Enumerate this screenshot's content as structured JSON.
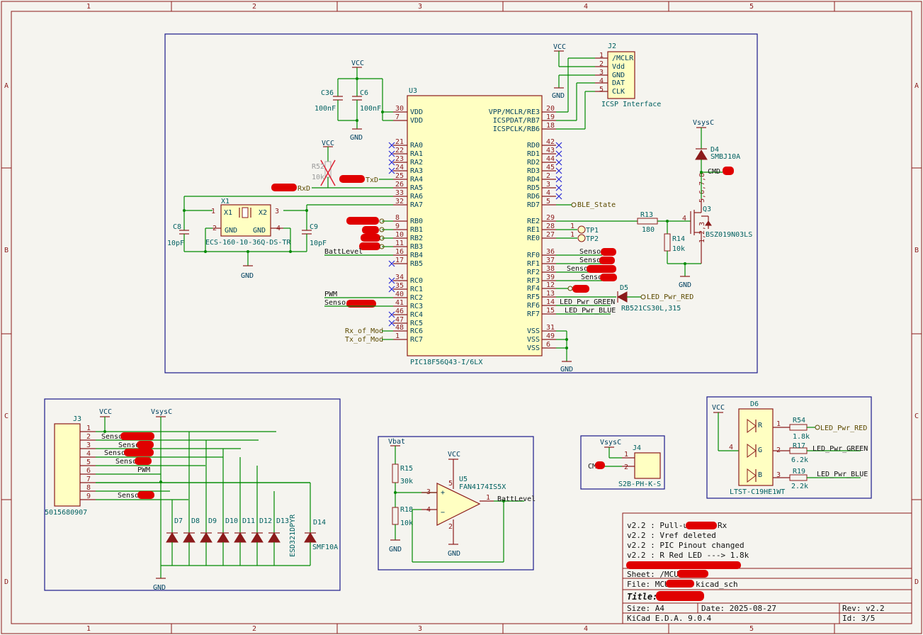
{
  "title_block": {
    "revisions": [
      "v2.2 : Pull-up",
      "v2.2 : Vref deleted",
      "v2.2 : PIC Pinout changed",
      "v2.2 : R Red LED ---> 1.8k"
    ],
    "revision_suffix_rx": "Rx",
    "sheet_label": "Sheet: /MCU",
    "file_label": "File: MCU",
    "file_suffix": "kicad_sch",
    "title_label": "Title:",
    "size": "Size: A4",
    "date": "Date: 2025-08-27",
    "rev": "Rev: v2.2",
    "kicad": "KiCad E.D.A. 9.0.4",
    "id": "Id: 3/5"
  },
  "zones": {
    "cols": [
      "1",
      "2",
      "3",
      "4",
      "5"
    ],
    "rows": [
      "A",
      "B",
      "C",
      "D"
    ]
  },
  "mcu": {
    "ref": "U3",
    "part": "PIC18F56Q43-I/6LX",
    "left_pins": [
      {
        "num": "30",
        "name": "VDD"
      },
      {
        "num": "7",
        "name": "VDD"
      },
      {
        "num": "21",
        "name": "RA0"
      },
      {
        "num": "22",
        "name": "RA1"
      },
      {
        "num": "23",
        "name": "RA2"
      },
      {
        "num": "24",
        "name": "RA3"
      },
      {
        "num": "25",
        "name": "RA4"
      },
      {
        "num": "26",
        "name": "RA5"
      },
      {
        "num": "33",
        "name": "RA6"
      },
      {
        "num": "32",
        "name": "RA7"
      },
      {
        "num": "8",
        "name": "RB0"
      },
      {
        "num": "9",
        "name": "RB1"
      },
      {
        "num": "10",
        "name": "RB2"
      },
      {
        "num": "11",
        "name": "RB3"
      },
      {
        "num": "16",
        "name": "RB4"
      },
      {
        "num": "17",
        "name": "RB5"
      },
      {
        "num": "34",
        "name": "RC0"
      },
      {
        "num": "35",
        "name": "RC1"
      },
      {
        "num": "40",
        "name": "RC2"
      },
      {
        "num": "41",
        "name": "RC3"
      },
      {
        "num": "46",
        "name": "RC4"
      },
      {
        "num": "47",
        "name": "RC5"
      },
      {
        "num": "48",
        "name": "RC6"
      },
      {
        "num": "1",
        "name": "RC7"
      }
    ],
    "right_pins": [
      {
        "num": "20",
        "name": "VPP/MCLR/RE3"
      },
      {
        "num": "19",
        "name": "ICSPDAT/RB7"
      },
      {
        "num": "18",
        "name": "ICSPCLK/RB6"
      },
      {
        "num": "42",
        "name": "RD0"
      },
      {
        "num": "43",
        "name": "RD1"
      },
      {
        "num": "44",
        "name": "RD2"
      },
      {
        "num": "45",
        "name": "RD3"
      },
      {
        "num": "2",
        "name": "RD4"
      },
      {
        "num": "3",
        "name": "RD5"
      },
      {
        "num": "4",
        "name": "RD6"
      },
      {
        "num": "5",
        "name": "RD7"
      },
      {
        "num": "29",
        "name": "RE2"
      },
      {
        "num": "28",
        "name": "RE1"
      },
      {
        "num": "27",
        "name": "RE0"
      },
      {
        "num": "36",
        "name": "RF0"
      },
      {
        "num": "37",
        "name": "RF1"
      },
      {
        "num": "38",
        "name": "RF2"
      },
      {
        "num": "39",
        "name": "RF3"
      },
      {
        "num": "12",
        "name": "RF4"
      },
      {
        "num": "13",
        "name": "RF5"
      },
      {
        "num": "14",
        "name": "RF6"
      },
      {
        "num": "15",
        "name": "RF7"
      },
      {
        "num": "31",
        "name": "VSS"
      },
      {
        "num": "49",
        "name": "VSS"
      },
      {
        "num": "6",
        "name": "VSS"
      }
    ]
  },
  "labels": {
    "vcc": "VCC",
    "gnd": "GND",
    "vsysc": "VsysC",
    "vbat": "Vbat",
    "txd": "TxD",
    "rxd": "RxD",
    "battlevel": "BattLevel",
    "pwm": "PWM",
    "sensor": "Sensor",
    "rx_of_mod": "Rx_of_Mod",
    "tx_of_mod": "Tx_of_Mod",
    "ble_state": "BLE_State",
    "led_red": "LED_Pwr_RED",
    "led_green": "LED_Pwr_GREEN",
    "led_blue": "LED_Pwr_BLUE",
    "cmd": "CMD",
    "tp1": "TP1",
    "tp2": "TP2"
  },
  "parts": {
    "c36": {
      "ref": "C36",
      "val": "100nF"
    },
    "c6": {
      "ref": "C6",
      "val": "100nF"
    },
    "r52": {
      "ref": "R52",
      "val": "10k"
    },
    "x1": {
      "ref": "X1",
      "val": "ECS-160-10-36Q-DS-TR",
      "p1": "X1",
      "p2": "X2",
      "g1": "GND",
      "g2": "GND"
    },
    "c8": {
      "ref": "C8",
      "val": "10pF"
    },
    "c9": {
      "ref": "C9",
      "val": "10pF"
    },
    "j2": {
      "ref": "J2",
      "val": "ICSP Interface",
      "pins": [
        "/MCLR",
        "Vdd",
        "GND",
        "DAT",
        "CLK"
      ]
    },
    "d4": {
      "ref": "D4",
      "val": "SMBJ10A"
    },
    "q3": {
      "ref": "Q3",
      "val": "BSZ019N03LS",
      "pins_d": "5,6,7,8",
      "pins_s": "1,2,3"
    },
    "r13": {
      "ref": "R13",
      "val": "180"
    },
    "r14": {
      "ref": "R14",
      "val": "10k"
    },
    "d5": {
      "ref": "D5",
      "val": "RB521CS30L,315"
    },
    "j3": {
      "ref": "J3",
      "val": "5015680907"
    },
    "d7": {
      "ref": "D7"
    },
    "d8": {
      "ref": "D8"
    },
    "d9": {
      "ref": "D9"
    },
    "d10": {
      "ref": "D10"
    },
    "d11": {
      "ref": "D11"
    },
    "d12": {
      "ref": "D12"
    },
    "d13": {
      "ref": "D13"
    },
    "esd": {
      "val": "ESD321DPYR"
    },
    "d14": {
      "ref": "D14",
      "val": "SMF10A"
    },
    "u5": {
      "ref": "U5",
      "val": "FAN4174IS5X"
    },
    "r15": {
      "ref": "R15",
      "val": "30k"
    },
    "r18": {
      "ref": "R18",
      "val": "10k"
    },
    "j4": {
      "ref": "J4",
      "val": "S2B-PH-K-S"
    },
    "d6": {
      "ref": "D6",
      "val": "LTST-C19HE1WT",
      "r": "R",
      "g": "G",
      "b": "B"
    },
    "r54": {
      "ref": "R54",
      "val": "1.8k"
    },
    "r17": {
      "ref": "R17",
      "val": "6.2k"
    },
    "r19": {
      "ref": "R19",
      "val": "2.2k"
    }
  }
}
